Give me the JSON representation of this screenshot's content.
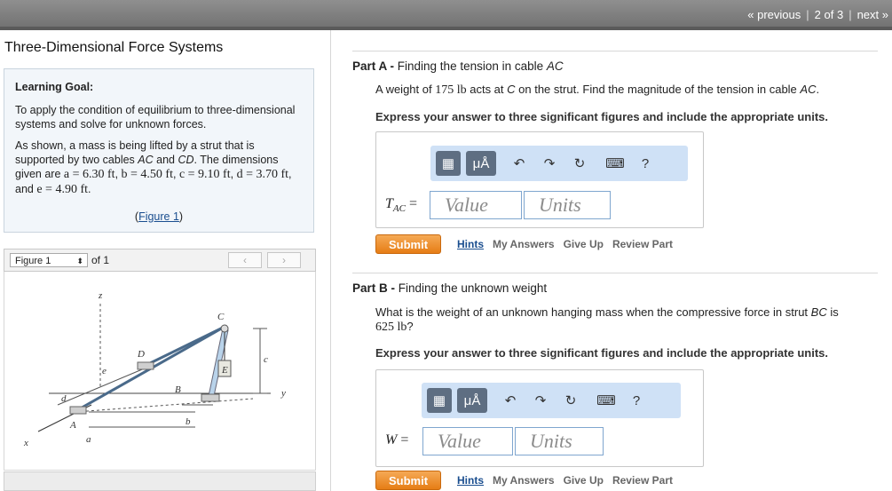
{
  "pager": {
    "previous": "« previous",
    "position": "2 of 3",
    "next": "next »"
  },
  "left": {
    "title": "Three-Dimensional Force Systems",
    "goal_heading": "Learning Goal:",
    "goal_text": "To apply the condition of equilibrium to three-dimensional systems and solve for unknown forces.",
    "desc_1": "As shown, a mass is being lifted by a strut that is supported by two cables ",
    "desc_ac": "AC",
    "desc_2": " and ",
    "desc_cd": "CD",
    "desc_3": ". The dimensions given are ",
    "dims": [
      "a = 6.30 ft",
      "b = 4.50 ft",
      "c = 9.10 ft",
      "d = 3.70 ft",
      "e = 4.90 ft"
    ],
    "and": "and",
    "figure_link": "Figure 1",
    "figure_link_prefix": "(",
    "figure_link_suffix": ")",
    "figure_select": "Figure 1",
    "figure_of": "of 1",
    "fig_labels": {
      "z": "z",
      "C": "C",
      "D": "D",
      "e": "e",
      "c": "c",
      "E": "E",
      "B": "B",
      "d": "d",
      "y": "y",
      "A": "A",
      "b": "b",
      "x": "x",
      "a": "a"
    }
  },
  "partA": {
    "label": "Part A -",
    "title": "Finding the tension in cable ",
    "title_var": "AC",
    "prompt_1": "A weight of ",
    "prompt_weight": "175 lb",
    "prompt_2": " acts at ",
    "prompt_c": "C",
    "prompt_3": " on the strut. Find the magnitude of the tension in cable ",
    "prompt_ac": "AC",
    "prompt_4": ".",
    "instruction": "Express your answer to three significant figures and include the appropriate units.",
    "eq_label": "T",
    "eq_sub": "AC",
    "eq_sign": "=",
    "value_placeholder": "Value",
    "units_placeholder": "Units",
    "submit": "Submit",
    "hints": "Hints",
    "my_answers": "My Answers",
    "give_up": "Give Up",
    "review": "Review Part"
  },
  "partB": {
    "label": "Part B -",
    "title": "Finding the unknown weight",
    "prompt_1": "What is the weight of an unknown hanging mass when the compressive force in strut ",
    "prompt_bc": "BC",
    "prompt_2": " is",
    "prompt_force": "625 lb",
    "prompt_3": "?",
    "instruction": "Express your answer to three significant figures and include the appropriate units.",
    "eq_label": "W",
    "eq_sign": "=",
    "value_placeholder": "Value",
    "units_placeholder": "Units",
    "submit": "Submit",
    "hints": "Hints",
    "my_answers": "My Answers",
    "give_up": "Give Up",
    "review": "Review Part"
  },
  "toolbar": {
    "mu_label": "μÅ",
    "help": "?"
  },
  "icons": [
    "templates-icon",
    "units-icon",
    "undo-icon",
    "redo-icon",
    "reset-icon",
    "keyboard-icon",
    "help-icon"
  ],
  "colors": {
    "accent": "#cfe1f6",
    "submit": "#e67d15",
    "link": "#1a4e8f",
    "topbar": "#7a7a7a"
  }
}
